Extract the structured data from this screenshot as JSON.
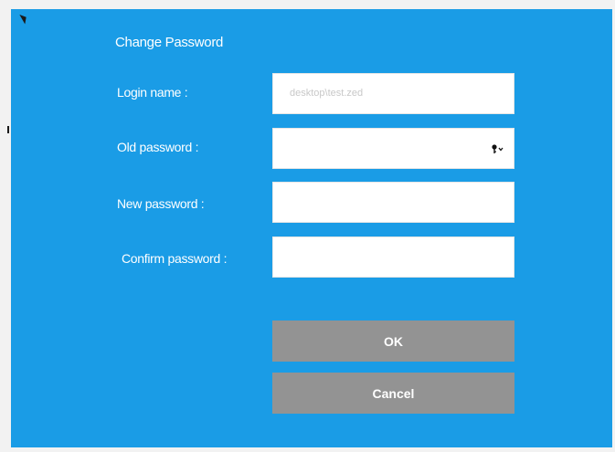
{
  "dialog": {
    "title": "Change Password",
    "background_color": "#1a9ce6"
  },
  "fields": {
    "login_name": {
      "label": "Login name :",
      "placeholder": "desktop\\test.zed",
      "value": ""
    },
    "old_password": {
      "label": "Old password :",
      "value": "",
      "icon": "key-dropdown-icon"
    },
    "new_password": {
      "label": "New password :",
      "value": ""
    },
    "confirm_password": {
      "label": "Confirm password :",
      "value": ""
    }
  },
  "buttons": {
    "ok_label": "OK",
    "cancel_label": "Cancel",
    "color": "#939393"
  }
}
